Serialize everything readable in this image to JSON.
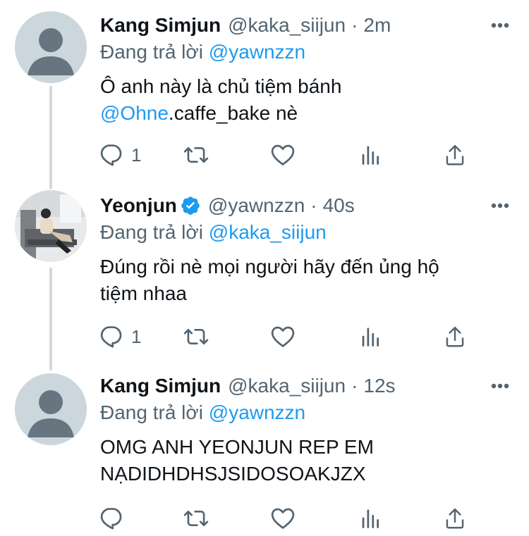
{
  "tweets": [
    {
      "name": "Kang Simjun",
      "handle": "@kaka_siijun",
      "dot": "·",
      "time": "2m",
      "verified": false,
      "avatar": "default-avatar",
      "reply_prefix": "Đang trả lời",
      "reply_to": "@yawnzzn",
      "text_line1": "Ô anh này là chủ tiệm bánh",
      "text_line2_mention": "@Ohne",
      "text_line2_rest": ".caffe_bake nè",
      "reply_count": "1"
    },
    {
      "name": "Yeonjun",
      "handle": "@yawnzzn",
      "dot": "·",
      "time": "40s",
      "verified": true,
      "avatar": "profile-photo",
      "reply_prefix": "Đang trả lời",
      "reply_to": "@kaka_siijun",
      "text_line1": "Đúng rồi nè mọi người hãy đến ủng hộ",
      "text_line2": "tiệm nhaa",
      "reply_count": "1"
    },
    {
      "name": "Kang Simjun",
      "handle": "@kaka_siijun",
      "dot": "·",
      "time": "12s",
      "verified": false,
      "avatar": "default-avatar",
      "reply_prefix": "Đang trả lời",
      "reply_to": "@yawnzzn",
      "text_line1": "OMG ANH YEONJUN REP EM",
      "text_line2": "NẠDIDHDHSJSIDOSOAKJZX",
      "reply_count": ""
    }
  ],
  "icons": [
    "reply-icon",
    "retweet-icon",
    "like-icon",
    "analytics-icon",
    "share-icon",
    "more-icon",
    "verified-badge-icon"
  ],
  "colors": {
    "link": "#1d9bf0",
    "secondary": "#536471",
    "text": "#0f1419",
    "thread_line": "#cfd9de",
    "verified": "#1d9bf0"
  }
}
